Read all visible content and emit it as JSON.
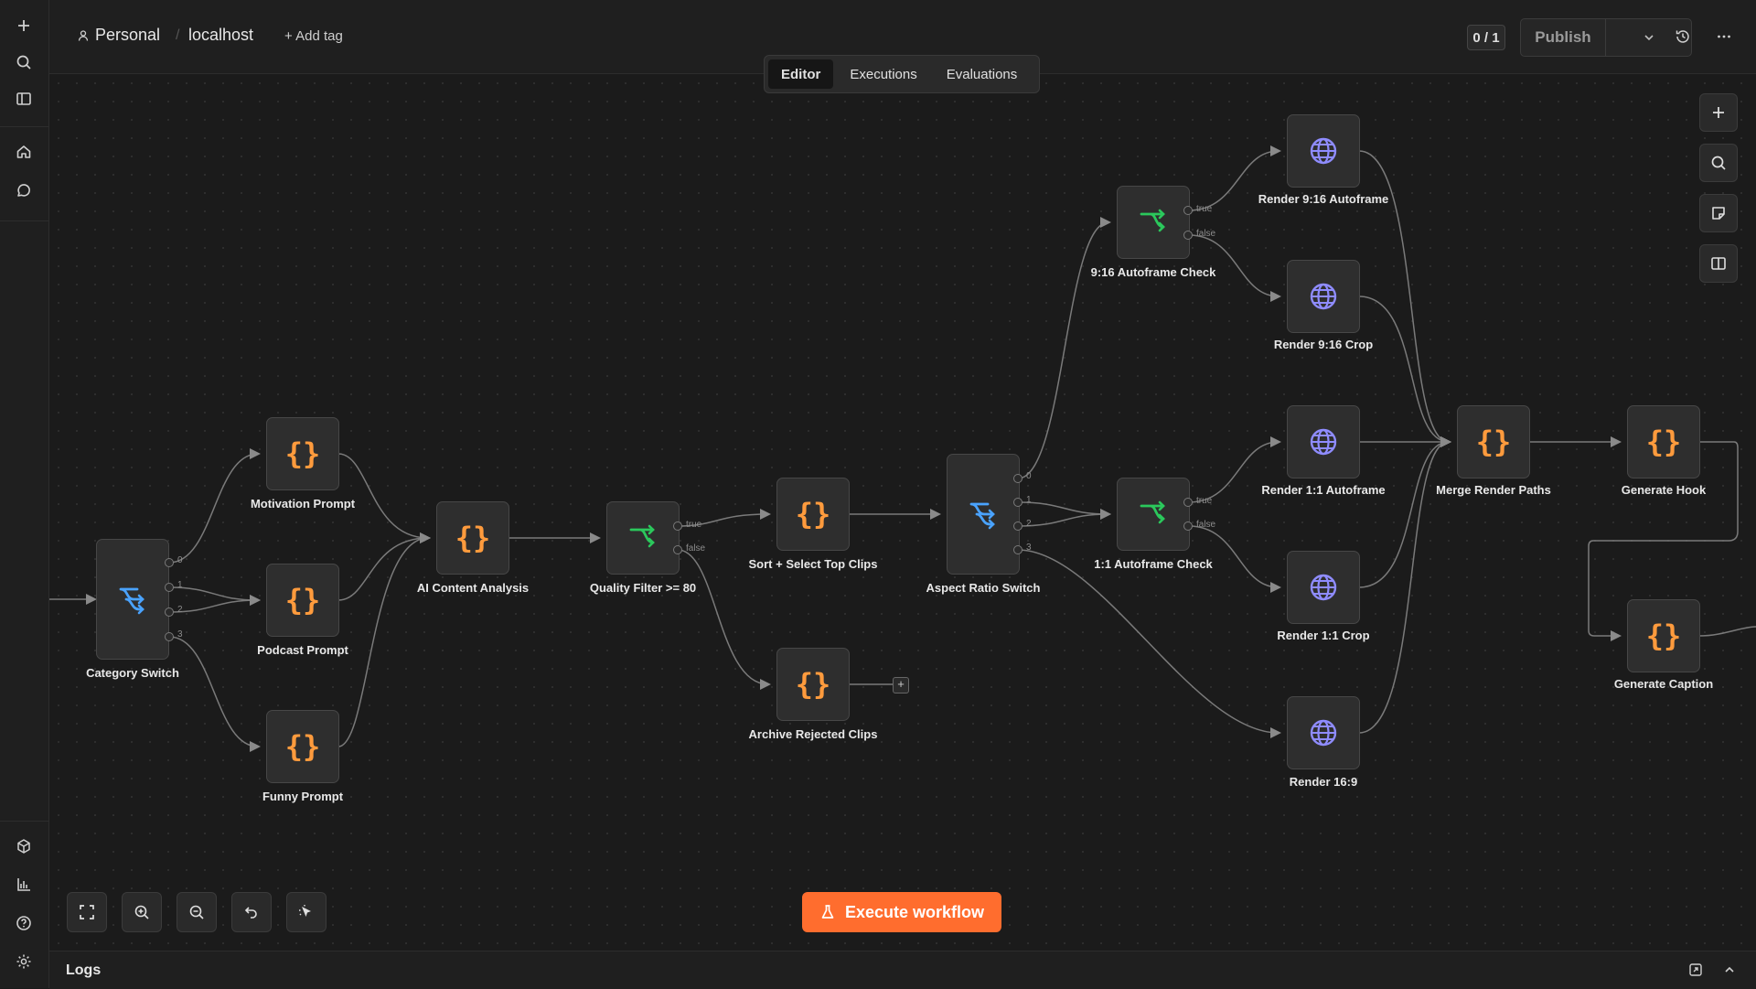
{
  "header": {
    "project": "Personal",
    "workflow_name": "localhost",
    "add_tag": "+ Add tag",
    "counter": "0 / 1",
    "publish_label": "Publish"
  },
  "tabs": [
    {
      "label": "Editor",
      "active": true
    },
    {
      "label": "Executions",
      "active": false
    },
    {
      "label": "Evaluations",
      "active": false
    }
  ],
  "nodes": [
    {
      "id": "category-switch",
      "label": "Category Switch",
      "icon": "switch-icon"
    },
    {
      "id": "motivation-prompt",
      "label": "Motivation Prompt",
      "icon": "code-braces-icon"
    },
    {
      "id": "podcast-prompt",
      "label": "Podcast Prompt",
      "icon": "code-braces-icon"
    },
    {
      "id": "funny-prompt",
      "label": "Funny Prompt",
      "icon": "code-braces-icon"
    },
    {
      "id": "ai-content-analysis",
      "label": "AI Content Analysis",
      "icon": "code-braces-icon"
    },
    {
      "id": "quality-filter",
      "label": "Quality Filter >= 80",
      "icon": "if-icon"
    },
    {
      "id": "sort-select",
      "label": "Sort + Select Top Clips",
      "icon": "code-braces-icon"
    },
    {
      "id": "archive-rejected",
      "label": "Archive Rejected Clips",
      "icon": "code-braces-icon"
    },
    {
      "id": "aspect-ratio-switch",
      "label": "Aspect Ratio Switch",
      "icon": "switch-icon"
    },
    {
      "id": "autoframe-check-916",
      "label": "9:16 Autoframe Check",
      "icon": "if-icon"
    },
    {
      "id": "autoframe-check-11",
      "label": "1:1 Autoframe Check",
      "icon": "if-icon"
    },
    {
      "id": "render-916-autoframe",
      "label": "Render 9:16 Autoframe",
      "icon": "globe-icon"
    },
    {
      "id": "render-916-crop",
      "label": "Render 9:16 Crop",
      "icon": "globe-icon"
    },
    {
      "id": "render-11-autoframe",
      "label": "Render 1:1 Autoframe",
      "icon": "globe-icon"
    },
    {
      "id": "render-11-crop",
      "label": "Render 1:1 Crop",
      "icon": "globe-icon"
    },
    {
      "id": "render-169",
      "label": "Render 16:9",
      "icon": "globe-icon"
    },
    {
      "id": "merge-render-paths",
      "label": "Merge Render Paths",
      "icon": "code-braces-icon"
    },
    {
      "id": "generate-hook",
      "label": "Generate Hook",
      "icon": "code-braces-icon"
    },
    {
      "id": "generate-caption",
      "label": "Generate Caption",
      "icon": "code-braces-icon"
    }
  ],
  "port_labels": {
    "switch_outputs": [
      "0",
      "1",
      "2",
      "3"
    ],
    "if_true": "true",
    "if_false": "false"
  },
  "execute_label": "Execute workflow",
  "logs_label": "Logs",
  "colors": {
    "accent": "#ff6d2e",
    "code_icon": "#ff9b3d",
    "switch_icon": "#4aa3ff",
    "if_icon": "#2bc85c",
    "globe_icon": "#8f8cff"
  }
}
